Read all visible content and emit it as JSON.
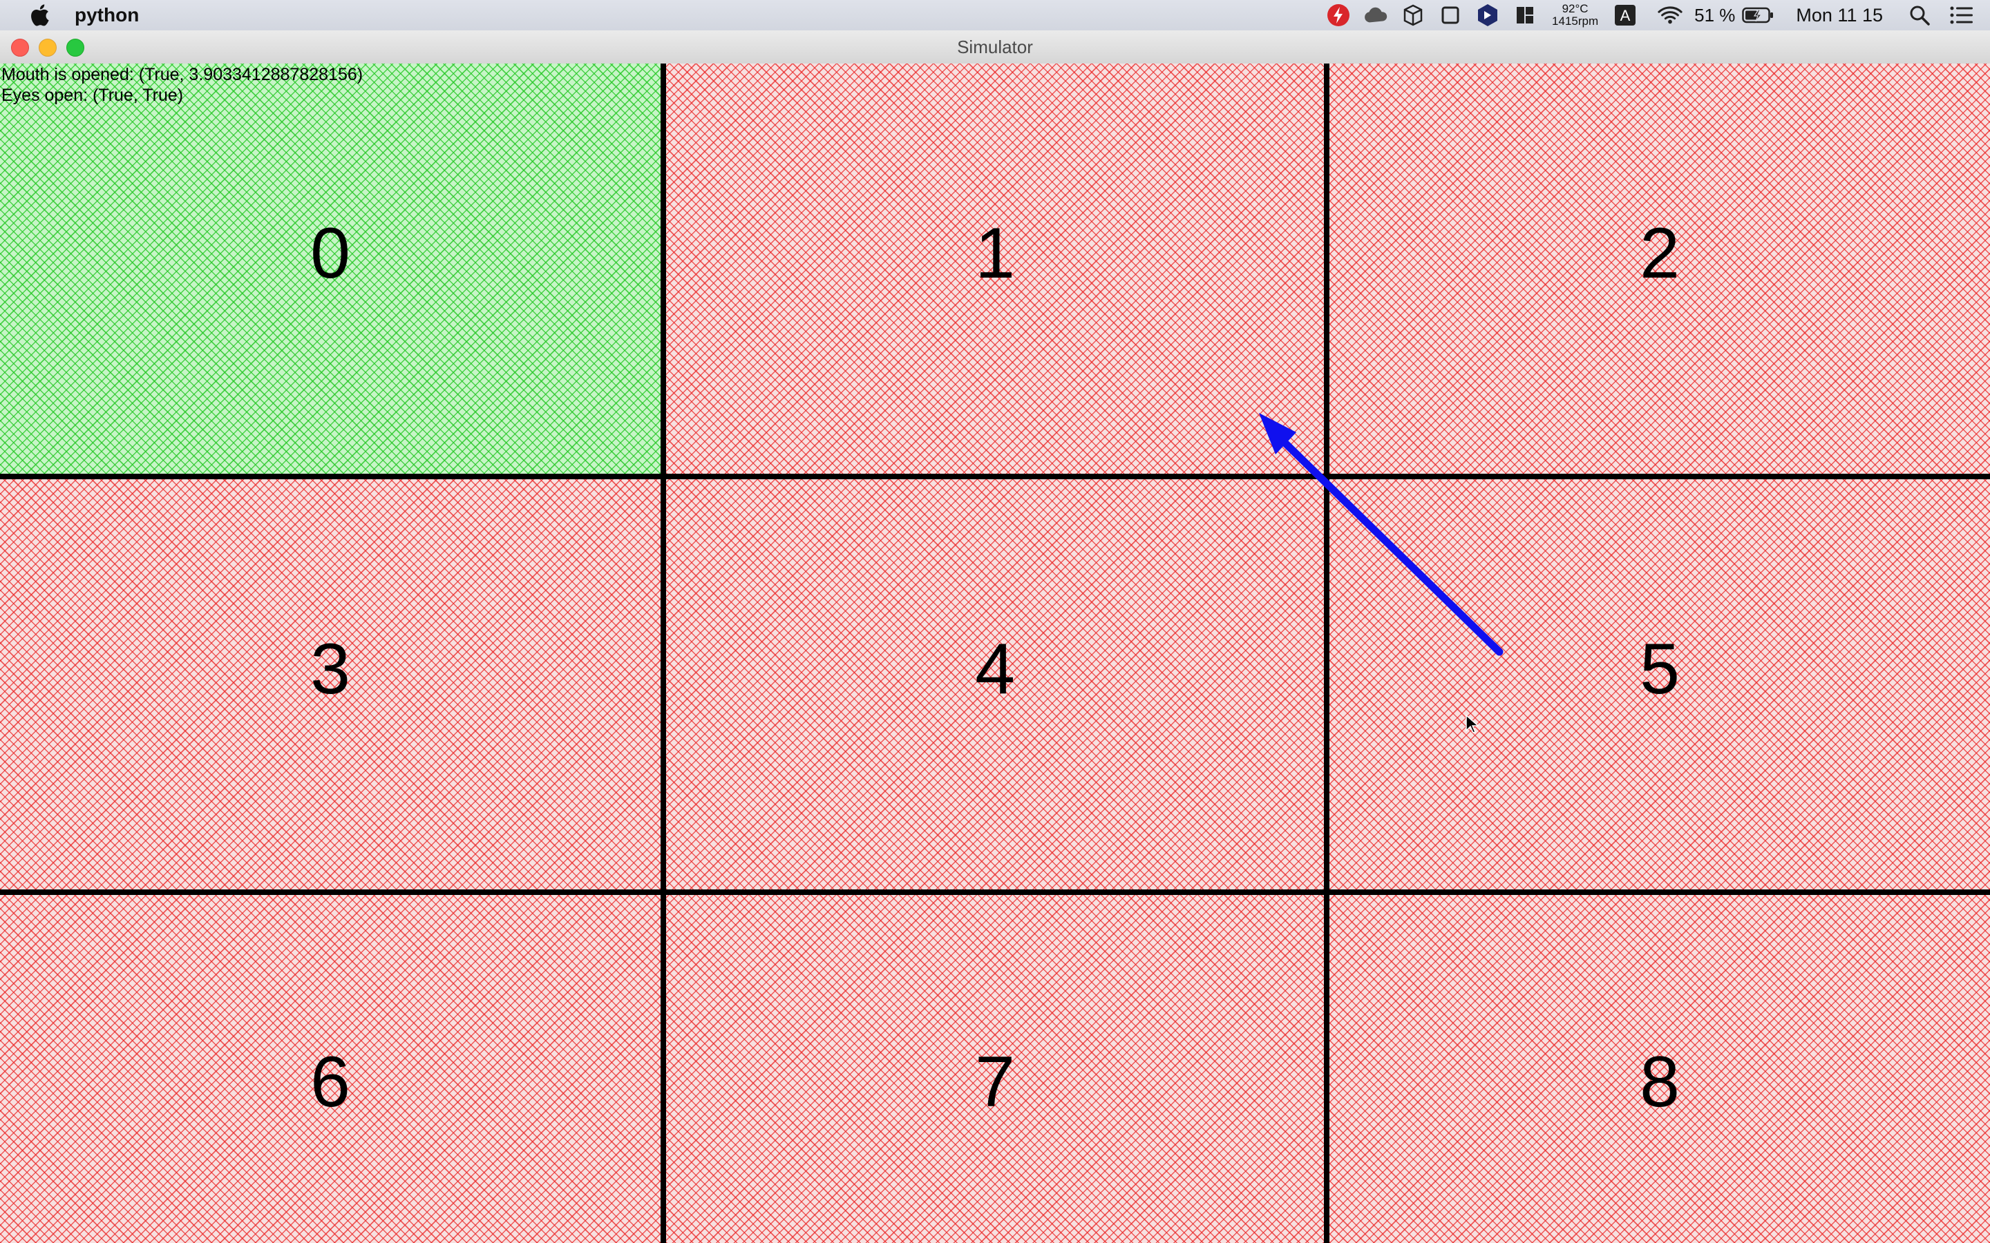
{
  "menubar": {
    "app_name": "python",
    "temperature": "92°C",
    "fan_speed": "1415rpm",
    "input_source": "A",
    "battery_percent": "51 %",
    "clock": "Mon 11 15",
    "icons": [
      "apple-icon",
      "flash-icon",
      "cloud-icon",
      "box-icon",
      "square-icon",
      "hexagon-icon",
      "layout-icon",
      "wifi-icon",
      "battery-icon",
      "search-icon",
      "list-icon"
    ]
  },
  "window": {
    "title": "Simulator"
  },
  "overlay": {
    "mouth_status": "Mouth is opened: (True, 3.9033412887828156)",
    "eyes_status": "Eyes open: (True, True)"
  },
  "grid": {
    "cells": [
      {
        "label": "0",
        "state": "active"
      },
      {
        "label": "1",
        "state": "inactive"
      },
      {
        "label": "2",
        "state": "inactive"
      },
      {
        "label": "3",
        "state": "inactive"
      },
      {
        "label": "4",
        "state": "inactive"
      },
      {
        "label": "5",
        "state": "inactive"
      },
      {
        "label": "6",
        "state": "inactive"
      },
      {
        "label": "7",
        "state": "inactive"
      },
      {
        "label": "8",
        "state": "inactive"
      }
    ],
    "colors": {
      "active": "#2ecc40",
      "inactive": "#e82828",
      "arrow": "#1010ee",
      "gridline": "#000000"
    }
  }
}
